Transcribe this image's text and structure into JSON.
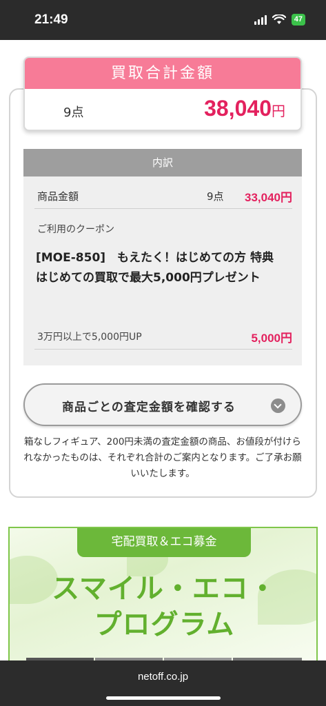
{
  "status": {
    "time": "21:49",
    "battery": "47"
  },
  "total": {
    "title": "買取合計金額",
    "count": "9点",
    "amount": "38,040",
    "yen": "円"
  },
  "breakdown": {
    "header": "内訳",
    "product_label": "商品金額",
    "product_count": "9点",
    "product_amount": "33,040円",
    "coupon_label": "ご利用のクーポン",
    "coupon_name": "[MOE-850]　もえたく！はじめての方 特典　はじめての買取で最大5,000円プレゼント",
    "coupon_condition": "3万円以上で5,000円UP",
    "coupon_amount": "5,000円"
  },
  "confirm_button": {
    "label": "商品ごとの査定金額を確認する"
  },
  "note": "箱なしフィギュア、200円未満の査定金額の商品、お値段が付けられなかったものは、それぞれ合計のご案内となります。ご了承お願いいたします。",
  "eco": {
    "tag": "宅配買取＆エコ募金",
    "title_line1": "スマイル・エコ・",
    "title_line2": "プログラム"
  },
  "browser": {
    "url": "netoff.co.jp"
  },
  "colors": {
    "accent_pink": "#e3215e",
    "header_pink": "#f77b97",
    "eco_green": "#62b02e"
  }
}
